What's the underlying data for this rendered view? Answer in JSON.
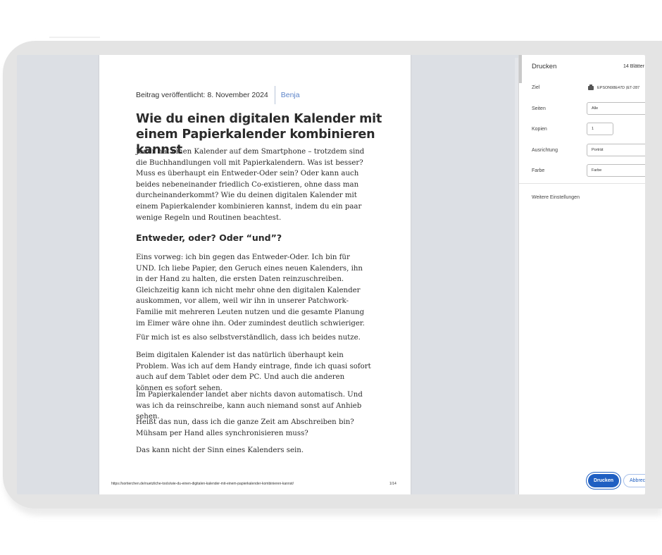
{
  "document": {
    "meta_date": "Beitrag veröffentlicht: 8. November 2024",
    "meta_author": "Benja",
    "title": "Wie du einen digitalen Kalender mit einem Papierkalender kombinieren kannst",
    "intro": "Jeder hat einen Kalender auf dem Smartphone – trotzdem sind die Buchhandlungen voll mit Papierkalendern. Was ist besser? Muss es überhaupt ein Entweder-Oder sein? Oder kann auch beides nebeneinander friedlich Co-existieren, ohne dass man durcheinanderkommt? Wie du deinen digitalen Kalender mit einem Papierkalender kombinieren kannst, indem du ein paar wenige Regeln und Routinen beachtest.",
    "heading2": "Entweder, oder? Oder “und”?",
    "paragraphs": [
      "Eins vorweg: ich bin gegen das Entweder-Oder. Ich bin für UND. Ich liebe Papier, den Geruch eines neuen Kalenders, ihn in der Hand zu halten, die ersten Daten reinzuschreiben. Gleichzeitig kann ich nicht mehr ohne den digitalen Kalender auskommen, vor allem, weil wir ihn in unserer Patchwork-Familie mit mehreren Leuten nutzen und die gesamte Planung im Eimer wäre ohne ihn. Oder zumindest deutlich schwieriger.",
      "Für mich ist es also selbstverständlich, dass ich beides nutze.",
      "Beim digitalen Kalender ist das natürlich überhaupt kein Problem. Was ich auf dem Handy eintrage, finde ich quasi sofort auch auf dem Tablet oder dem PC. Und auch die anderen können es sofort sehen.",
      "Im Papierkalender landet aber nichts davon automatisch. Und was ich da reinschreibe, kann auch niemand sonst auf Anhieb sehen.",
      "Heißt das nun, dass ich die ganze Zeit am Abschreiben bin? Mühsam per Hand alles synchronisieren muss?",
      "Das kann nicht der Sinn eines Kalenders sein."
    ],
    "footer_url": "https://sortierchen.de/nuetzliche-tools/wie-du-einen-digitalen-kalender-mit-einem-papierkalender-kombinieren-kannst/",
    "footer_page": "1/14"
  },
  "print_panel": {
    "title": "Drucken",
    "sheets": "14 Blätter",
    "destination_label": "Ziel",
    "destination_value": "EPSON98E47D (ET-287",
    "pages_label": "Seiten",
    "pages_value": "Alle",
    "copies_label": "Kopien",
    "copies_value": "1",
    "orientation_label": "Ausrichtung",
    "orientation_value": "Porträt",
    "color_label": "Farbe",
    "color_value": "Farbe",
    "more_settings": "Weitere Einstellungen",
    "print_button": "Drucken",
    "cancel_button": "Abbrechen"
  }
}
